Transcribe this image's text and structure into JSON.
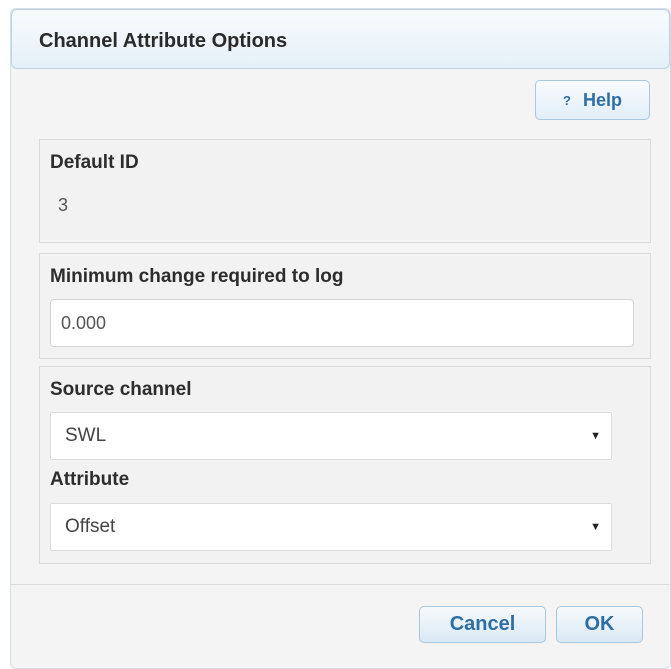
{
  "dialog": {
    "title": "Channel Attribute Options"
  },
  "help": {
    "icon": "?",
    "label": "Help"
  },
  "default_id": {
    "label": "Default ID",
    "value": "3"
  },
  "min_change": {
    "label": "Minimum change required to log",
    "value": "0.000"
  },
  "source_channel": {
    "label": "Source channel",
    "selected": "SWL"
  },
  "attribute": {
    "label": "Attribute",
    "selected": "Offset"
  },
  "footer": {
    "cancel_label": "Cancel",
    "ok_label": "OK"
  },
  "colors": {
    "accent": "#2f6ea3",
    "titlebar_border": "#b9d2e6"
  }
}
